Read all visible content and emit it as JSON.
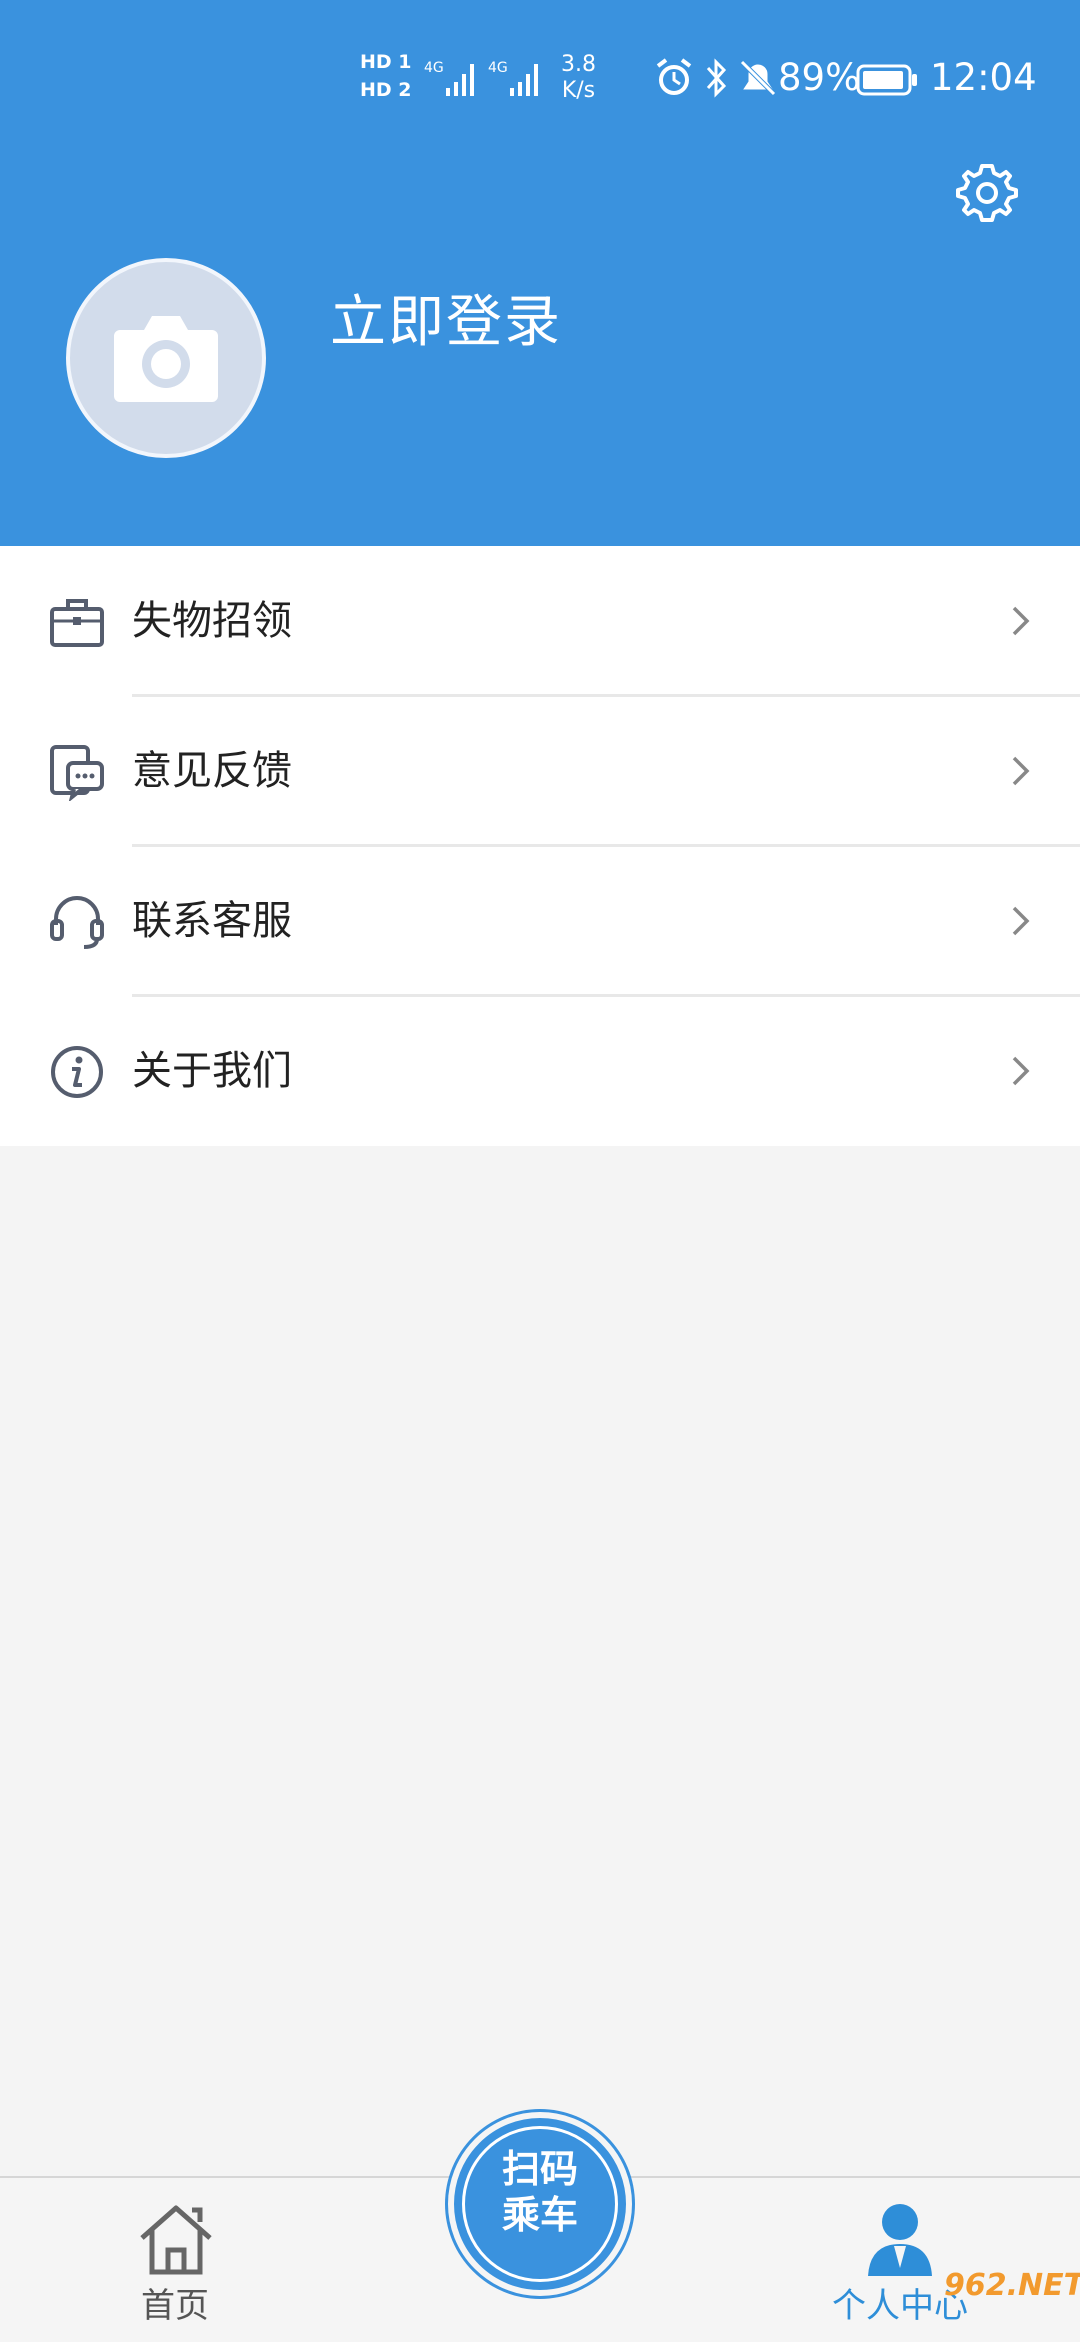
{
  "status_bar": {
    "sim1": "HD 1",
    "sim2": "HD 2",
    "net_type_1": "4G",
    "net_type_2": "4G",
    "speed_value": "3.8",
    "speed_unit": "K/s",
    "battery": "89%",
    "time": "12:04"
  },
  "profile": {
    "login_label": "立即登录"
  },
  "menu": {
    "items": [
      {
        "label": "失物招领",
        "icon": "briefcase-icon"
      },
      {
        "label": "意见反馈",
        "icon": "feedback-chat-icon"
      },
      {
        "label": "联系客服",
        "icon": "headset-icon"
      },
      {
        "label": "关于我们",
        "icon": "info-icon"
      }
    ]
  },
  "bottom_nav": {
    "home_label": "首页",
    "scan_line1": "扫码",
    "scan_line2": "乘车",
    "me_label": "个人中心"
  },
  "watermark": "962.NET",
  "colors": {
    "primary": "#3a92de",
    "background": "#f4f4f4",
    "menu_text": "#222222",
    "active_tab": "#2e8ed8"
  }
}
